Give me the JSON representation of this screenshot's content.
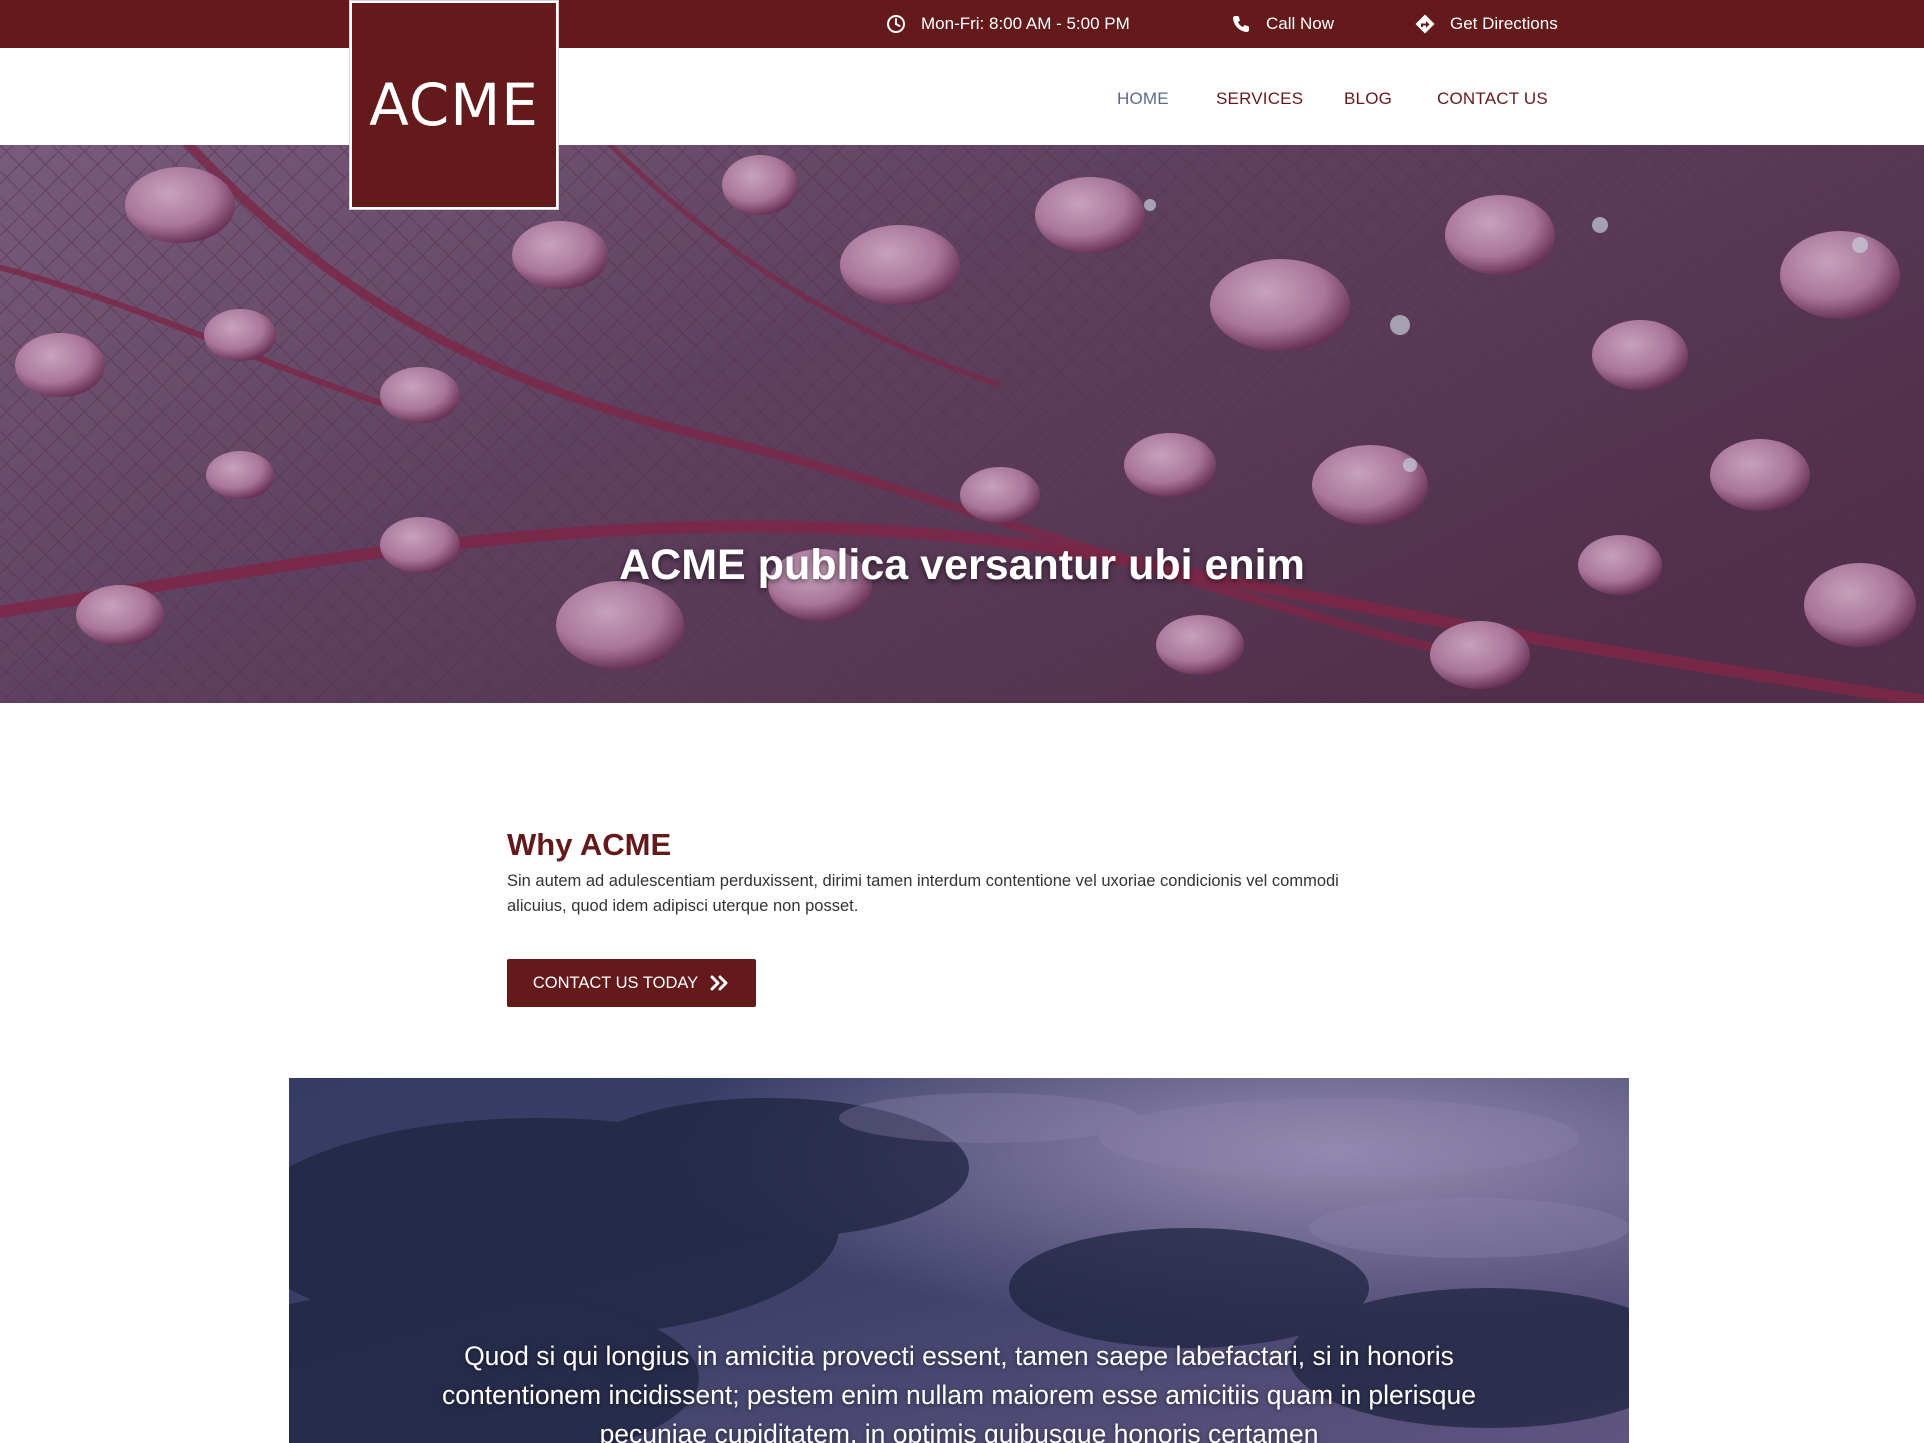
{
  "colors": {
    "brand": "#641a1b",
    "nav_active": "#5b6a86",
    "text": "#333333"
  },
  "topbar": {
    "hours": {
      "icon": "clock-icon",
      "text": "Mon-Fri: 8:00 AM - 5:00 PM"
    },
    "call": {
      "icon": "phone-icon",
      "text": "Call Now"
    },
    "directions": {
      "icon": "directions-icon",
      "text": "Get Directions"
    }
  },
  "logo": {
    "text": "ACME"
  },
  "nav": {
    "items": [
      {
        "label": "HOME",
        "active": true
      },
      {
        "label": "SERVICES"
      },
      {
        "label": "BLOG"
      },
      {
        "label": "CONTACT US"
      }
    ]
  },
  "hero": {
    "title": "ACME publica versantur ubi enim"
  },
  "why": {
    "title": "Why ACME",
    "text": "Sin autem ad adulescentiam perduxissent, dirimi tamen interdum contentione vel uxoriae condicionis vel commodi alicuius, quod idem adipisci uterque non posset.",
    "button": {
      "label": "CONTACT US TODAY",
      "icon": "double-chevron-right-icon"
    }
  },
  "quote": {
    "text": "Quod si qui longius in amicitia provecti essent, tamen saepe labefactari, si in honoris contentionem incidissent; pestem enim nullam maiorem esse amicitiis quam in plerisque pecuniae cupiditatem, in optimis quibusque honoris certamen"
  }
}
